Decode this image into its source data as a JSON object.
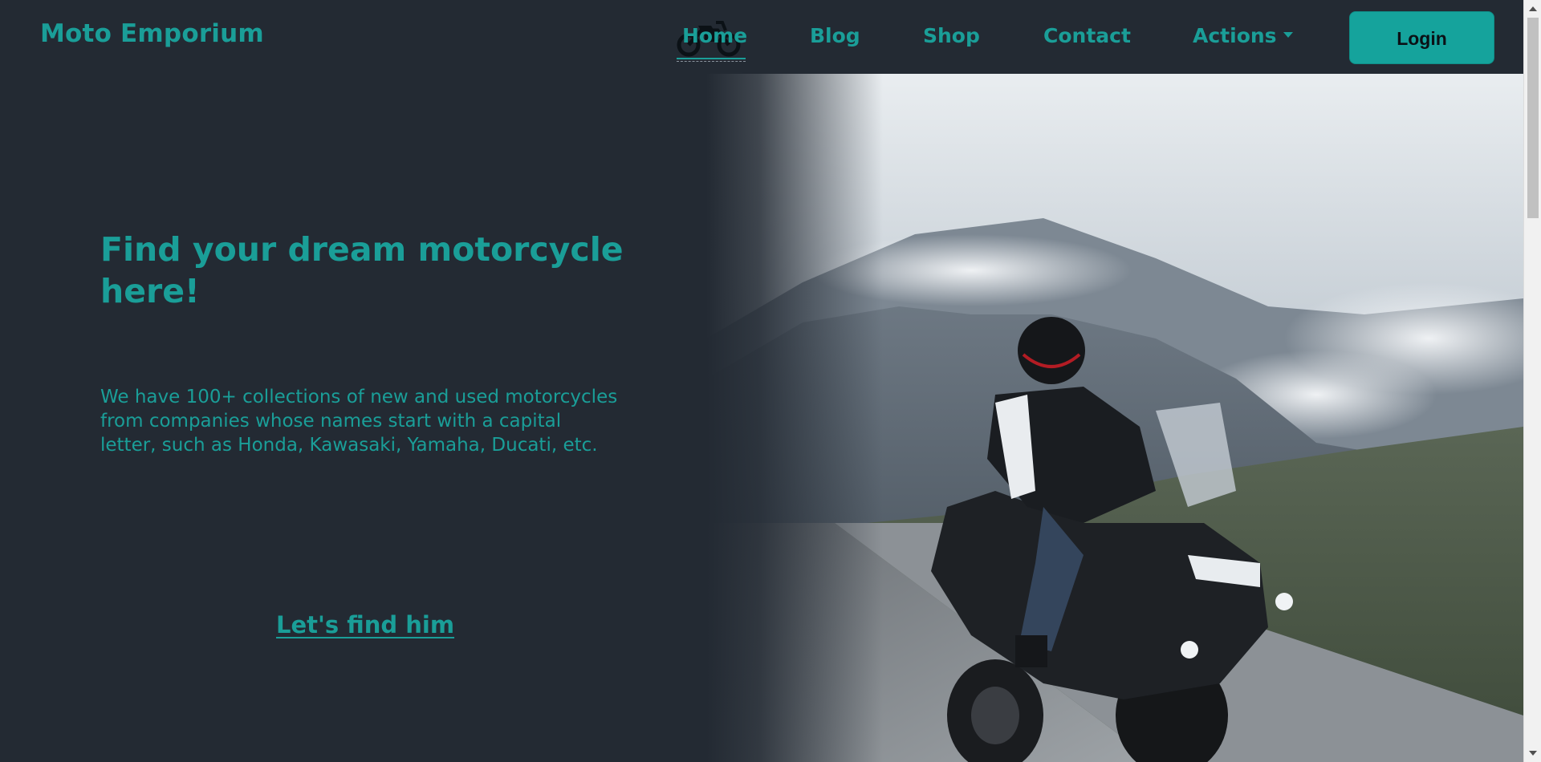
{
  "navbar": {
    "brand": "Moto Emporium",
    "links": {
      "home": "Home",
      "blog": "Blog",
      "shop": "Shop",
      "contact": "Contact",
      "actions": "Actions"
    },
    "login_label": "Login",
    "accent_color": "#1a9e98"
  },
  "hero": {
    "title": "Find your dream motorcycle here!",
    "description": "We have 100+ collections of new and used motorcycles from companies whose names start with a capital letter, such as Honda, Kawasaki, Yamaha, Ducati, etc.",
    "cta_label": "Let's find him",
    "background_color": "#232a33"
  },
  "icons": {
    "nav_home_decoration": "motorcycle-icon",
    "actions_dropdown": "caret-down-icon"
  }
}
